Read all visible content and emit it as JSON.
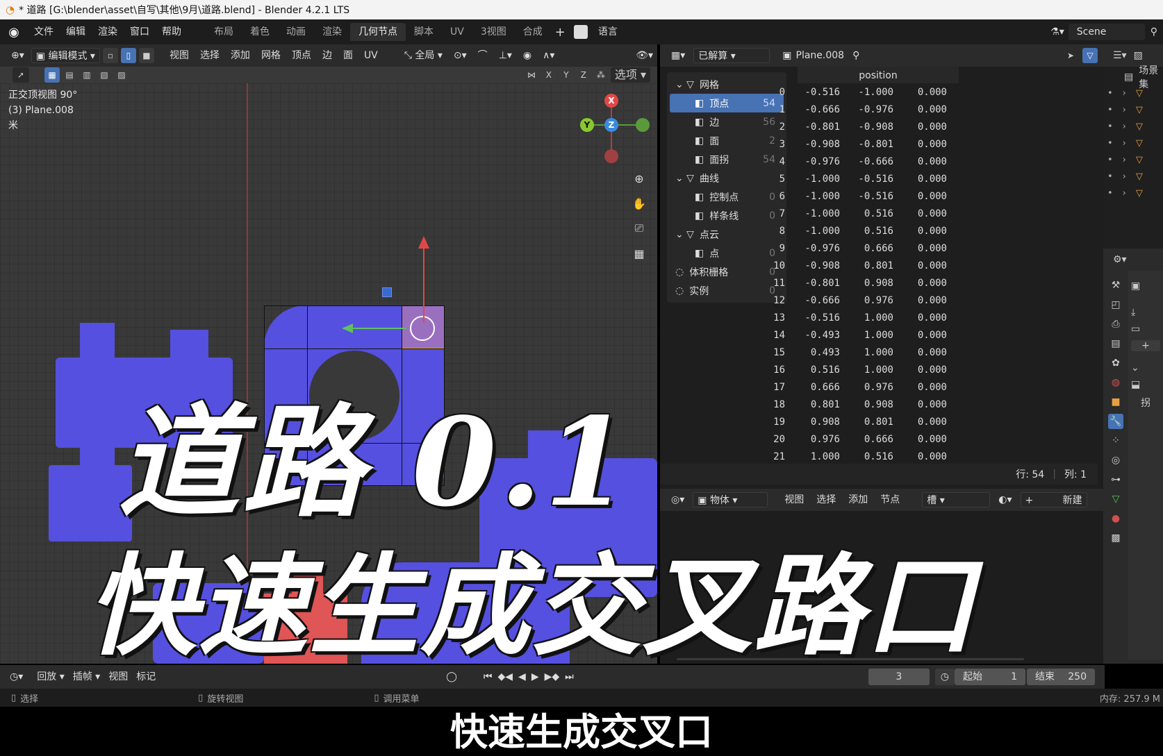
{
  "titlebar": {
    "title": "* 道路 [G:\\blender\\asset\\自写\\其他\\9月\\道路.blend] - Blender 4.2.1 LTS"
  },
  "topbar": {
    "menus": [
      "文件",
      "编辑",
      "渲染",
      "窗口",
      "帮助"
    ],
    "workspaces": [
      "布局",
      "着色",
      "动画",
      "渲染",
      "几何节点",
      "脚本",
      "UV",
      "3视图",
      "合成"
    ],
    "active_workspace": "几何节点",
    "language": "语言",
    "scene": "Scene"
  },
  "viewport_header": {
    "mode": "编辑模式",
    "menus": [
      "视图",
      "选择",
      "添加",
      "网格",
      "顶点",
      "边",
      "面",
      "UV"
    ],
    "transform_orientation": "全局",
    "axes": [
      "X",
      "Y",
      "Z"
    ],
    "options": "选项"
  },
  "viewport": {
    "view_name": "正交顶视图 90°",
    "object": "(3) Plane.008",
    "unit": "米",
    "gizmo": {
      "x": "X",
      "y": "Y",
      "z": "Z"
    }
  },
  "overlay_text": {
    "line1": "道路 0.1",
    "line2": "快速生成交叉路口"
  },
  "spreadsheet": {
    "eval_mode": "已解算",
    "object": "Plane.008",
    "column": "position",
    "tree": [
      {
        "label": "网格",
        "count": "",
        "level": 0
      },
      {
        "label": "顶点",
        "count": "54",
        "level": 1,
        "selected": true
      },
      {
        "label": "边",
        "count": "56",
        "level": 1
      },
      {
        "label": "面",
        "count": "2",
        "level": 1
      },
      {
        "label": "面拐",
        "count": "54",
        "level": 1
      },
      {
        "label": "曲线",
        "count": "",
        "level": 0
      },
      {
        "label": "控制点",
        "count": "0",
        "level": 1
      },
      {
        "label": "样条线",
        "count": "0",
        "level": 1
      },
      {
        "label": "点云",
        "count": "",
        "level": 0
      },
      {
        "label": "点",
        "count": "0",
        "level": 1
      },
      {
        "label": "体积栅格",
        "count": "0",
        "level": 0
      },
      {
        "label": "实例",
        "count": "0",
        "level": 0
      }
    ],
    "rows": [
      [
        "0",
        "-0.516",
        "-1.000",
        "0.000"
      ],
      [
        "1",
        "-0.666",
        "-0.976",
        "0.000"
      ],
      [
        "2",
        "-0.801",
        "-0.908",
        "0.000"
      ],
      [
        "3",
        "-0.908",
        "-0.801",
        "0.000"
      ],
      [
        "4",
        "-0.976",
        "-0.666",
        "0.000"
      ],
      [
        "5",
        "-1.000",
        "-0.516",
        "0.000"
      ],
      [
        "6",
        "-1.000",
        "-0.516",
        "0.000"
      ],
      [
        "7",
        "-1.000",
        "0.516",
        "0.000"
      ],
      [
        "8",
        "-1.000",
        "0.516",
        "0.000"
      ],
      [
        "9",
        "-0.976",
        "0.666",
        "0.000"
      ],
      [
        "10",
        "-0.908",
        "0.801",
        "0.000"
      ],
      [
        "11",
        "-0.801",
        "0.908",
        "0.000"
      ],
      [
        "12",
        "-0.666",
        "0.976",
        "0.000"
      ],
      [
        "13",
        "-0.516",
        "1.000",
        "0.000"
      ],
      [
        "14",
        "-0.493",
        "1.000",
        "0.000"
      ],
      [
        "15",
        "0.493",
        "1.000",
        "0.000"
      ],
      [
        "16",
        "0.516",
        "1.000",
        "0.000"
      ],
      [
        "17",
        "0.666",
        "0.976",
        "0.000"
      ],
      [
        "18",
        "0.801",
        "0.908",
        "0.000"
      ],
      [
        "19",
        "0.908",
        "0.801",
        "0.000"
      ],
      [
        "20",
        "0.976",
        "0.666",
        "0.000"
      ],
      [
        "21",
        "1.000",
        "0.516",
        "0.000"
      ]
    ],
    "rows_label": "行: 54",
    "cols_label": "列: 1"
  },
  "node_editor_header": {
    "type": "物体",
    "menus": [
      "视图",
      "选择",
      "添加",
      "节点"
    ],
    "slot": "槽",
    "new": "新建"
  },
  "outliner": {
    "title": "场景集"
  },
  "properties": {
    "label": "拐"
  },
  "timeline": {
    "playback": "回放",
    "keying": "插帧",
    "view": "视图",
    "marker": "标记",
    "current_frame": "3",
    "start_label": "起始",
    "start": "1",
    "end_label": "结束",
    "end": "250"
  },
  "statusbar": {
    "select": "选择",
    "rotate": "旋转视图",
    "menu": "调用菜单",
    "memory": "内存: 257.9 M"
  },
  "subtitle": "快速生成交叉口",
  "colors": {
    "accent": "#4772b3",
    "mesh": "#5550e0",
    "red_mesh": "#e05555",
    "selected_face": "#9a6fc0"
  }
}
